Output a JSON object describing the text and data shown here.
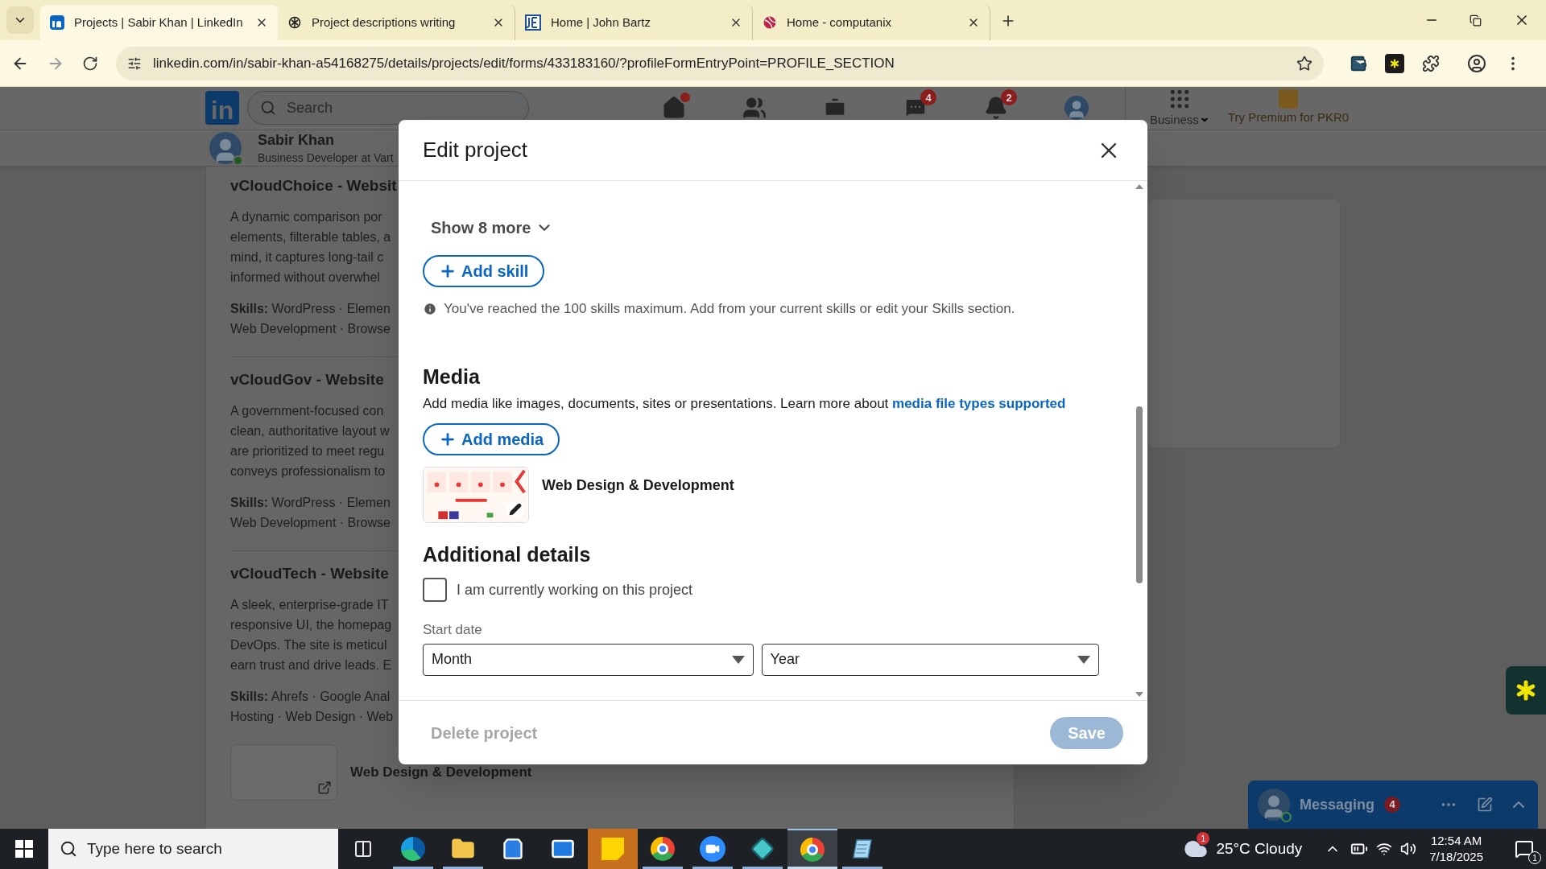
{
  "browser": {
    "tabs": [
      {
        "title": "Projects | Sabir Khan | LinkedIn",
        "kind": "linkedin",
        "selected": true
      },
      {
        "title": "Project descriptions writing",
        "kind": "openai",
        "selected": false
      },
      {
        "title": "Home | John Bartz",
        "kind": "jb",
        "selected": false
      },
      {
        "title": "Home - computanix",
        "kind": "computanix",
        "selected": false
      }
    ],
    "url": "linkedin.com/in/sabir-khan-a54168275/details/projects/edit/forms/433183160/?profileFormEntryPoint=PROFILE_SECTION"
  },
  "linkedin": {
    "logo": "in",
    "search_placeholder": "Search",
    "nav": [
      {
        "kind": "home",
        "badge_dot": true
      },
      {
        "kind": "network"
      },
      {
        "kind": "jobs"
      },
      {
        "kind": "messaging",
        "badge": "4"
      },
      {
        "kind": "notifications",
        "badge": "2"
      },
      {
        "kind": "me"
      }
    ],
    "business": "Business",
    "premium": "Try Premium for PKR0"
  },
  "profile_bar": {
    "name": "Sabir Khan",
    "headline": "Business Developer at Vart",
    "online": true
  },
  "projects": [
    {
      "title": "vCloudChoice - Websit",
      "description_lines": [
        "A dynamic comparison por",
        "elements, filterable tables, a",
        "mind, it captures long-tail c",
        "informed without overwhel"
      ],
      "skills_lines": [
        "**Skills:** WordPress · Elemen",
        "Web Development · Browse"
      ]
    },
    {
      "title": "vCloudGov - Website",
      "description_lines": [
        "A government-focused con",
        "clean, authoritative layout w",
        "are prioritized to meet regu",
        "conveys professionalism to"
      ],
      "skills_lines": [
        "**Skills:** WordPress · Elemen",
        "Web Development · Browse"
      ]
    },
    {
      "title": "vCloudTech - Website",
      "description_lines": [
        "A sleek, enterprise-grade IT",
        "responsive UI, the homepag",
        "DevOps. The site is meticul",
        "earn trust and drive leads. E"
      ],
      "skills_lines": [
        "**Skills:** Ahrefs · Google Anal",
        "Hosting · Web Design · Web"
      ]
    }
  ],
  "media_card": {
    "title": "Web Design & Development"
  },
  "modal": {
    "title": "Edit project",
    "show_more": "Show 8 more",
    "add_skill": "Add skill",
    "skills_notice": "You've reached the 100 skills maximum. Add from your current skills or edit your Skills section.",
    "media_heading": "Media",
    "media_description": "Add media like images, documents, sites or presentations. Learn more about ",
    "media_link": "media file types supported",
    "add_media": "Add media",
    "media_item": {
      "title": "Web Design & Development"
    },
    "additional_heading": "Additional details",
    "current_checkbox": {
      "label": "I am currently working on this project",
      "checked": false
    },
    "start_date_label": "Start date",
    "start_month": {
      "value": "Month"
    },
    "start_year": {
      "value": "Year"
    },
    "delete": {
      "label": "Delete project",
      "disabled": true
    },
    "save": {
      "label": "Save",
      "disabled": true
    }
  },
  "messaging": {
    "label": "Messaging",
    "badge": "4",
    "online": true
  },
  "taskbar": {
    "search_placeholder": "Type here to search",
    "apps": [
      {
        "kind": "taskview",
        "running": false,
        "selected": false,
        "flashing": false
      },
      {
        "kind": "edge",
        "running": true,
        "selected": false,
        "flashing": false
      },
      {
        "kind": "files",
        "running": true,
        "selected": false,
        "flashing": false
      },
      {
        "kind": "store",
        "running": false,
        "selected": false,
        "flashing": false
      },
      {
        "kind": "mail",
        "running": false,
        "selected": false,
        "flashing": false
      },
      {
        "kind": "sticky",
        "running": false,
        "selected": false,
        "flashing": true
      },
      {
        "kind": "chrome",
        "running": true,
        "selected": false,
        "flashing": false
      },
      {
        "kind": "zoom",
        "running": true,
        "selected": false,
        "flashing": false
      },
      {
        "kind": "diamond",
        "running": true,
        "selected": false,
        "flashing": false
      },
      {
        "kind": "chrome",
        "running": true,
        "selected": true,
        "flashing": false
      },
      {
        "kind": "notes",
        "running": true,
        "selected": false,
        "flashing": false
      }
    ],
    "weather": {
      "text": "25°C Cloudy",
      "badge": "1"
    },
    "time": "12:54 AM",
    "date": "7/18/2025",
    "notifications": "1"
  }
}
